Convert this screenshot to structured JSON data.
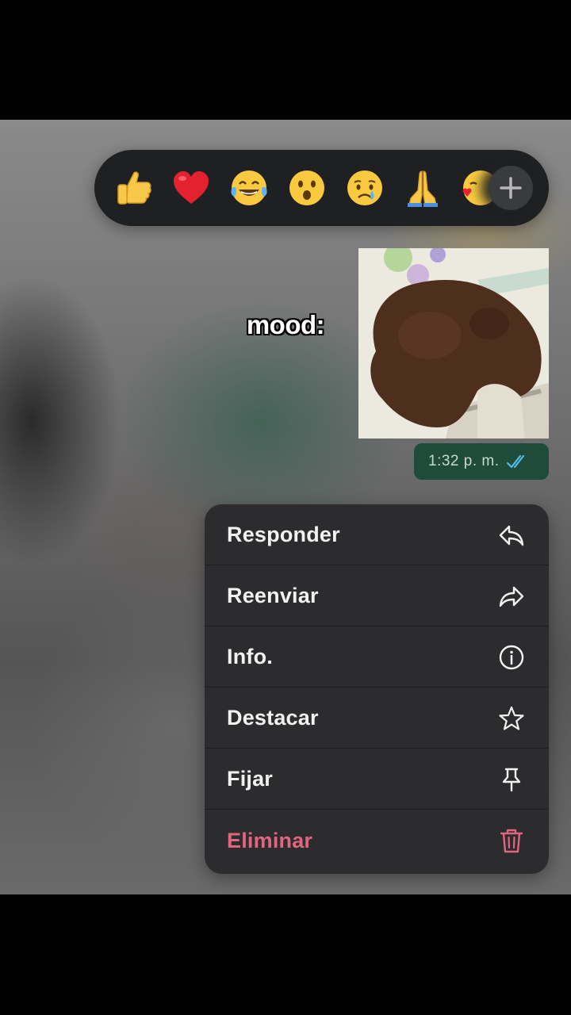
{
  "reactions": {
    "items": [
      {
        "name": "thumbs-up",
        "glyph": "👍"
      },
      {
        "name": "red-heart",
        "glyph": "❤️"
      },
      {
        "name": "tears-of-joy",
        "glyph": "😂"
      },
      {
        "name": "surprised-face",
        "glyph": "😮"
      },
      {
        "name": "crying-face",
        "glyph": "😢"
      },
      {
        "name": "folded-hands",
        "glyph": "🙏"
      },
      {
        "name": "face-blowing-kiss",
        "glyph": "😘"
      }
    ],
    "more_icon": "plus-icon"
  },
  "message": {
    "caption": "mood:",
    "image_icon": "bear-photo",
    "timestamp": "1:32 p. m.",
    "status_icon": "double-check-icon",
    "status_color": "#53bdeb"
  },
  "menu": {
    "items": [
      {
        "label": "Responder",
        "icon": "reply-icon"
      },
      {
        "label": "Reenviar",
        "icon": "forward-icon"
      },
      {
        "label": "Info.",
        "icon": "info-icon"
      },
      {
        "label": "Destacar",
        "icon": "star-icon"
      },
      {
        "label": "Fijar",
        "icon": "pin-icon"
      },
      {
        "label": "Eliminar",
        "icon": "trash-icon",
        "color": "#e0667f"
      }
    ]
  }
}
